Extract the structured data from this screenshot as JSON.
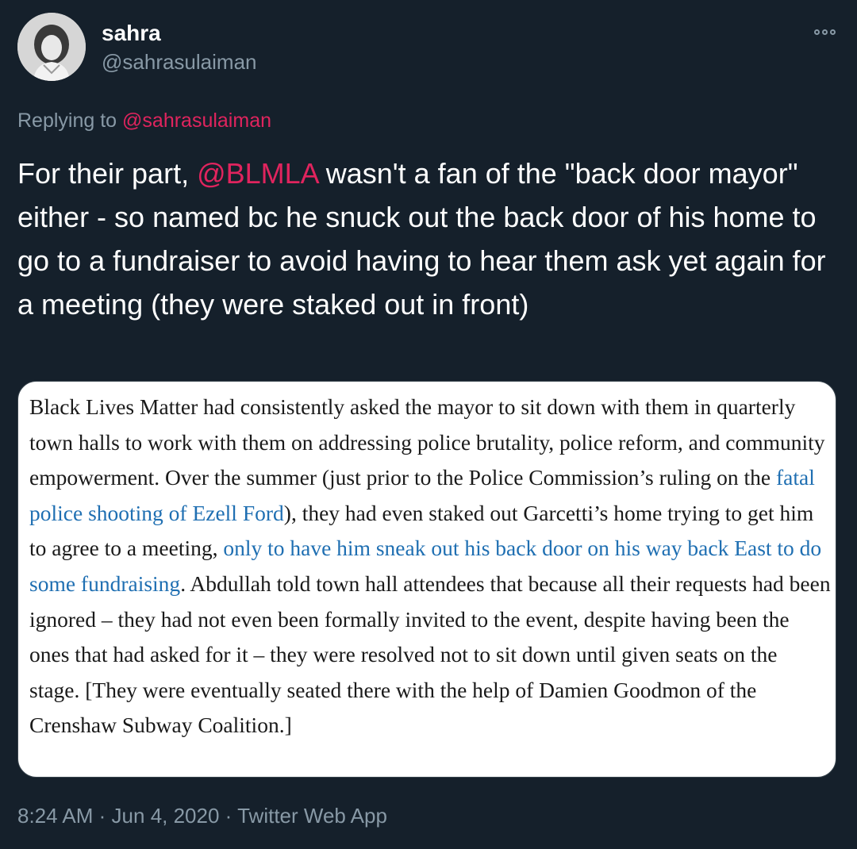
{
  "author": {
    "display_name": "sahra",
    "handle": "@sahrasulaiman"
  },
  "reply": {
    "prefix": "Replying to",
    "to_handle": "@sahrasulaiman"
  },
  "tweet": {
    "text_before_mention": "For their part,",
    "mention": "@BLMLA",
    "text_after_mention": "wasn't a fan of the \"back door mayor\" either - so named bc he snuck out the back door of his home to go to a fundraiser to avoid having to hear them ask yet again for a meeting (they were staked out in front)"
  },
  "quote_image": {
    "text_1": "Black Lives Matter had consistently asked the mayor to sit down with them in quarterly town halls to work with them on addressing police brutality, police reform, and community empowerment. Over the summer (just prior to the Police Commission’s ruling on the",
    "link_1": "fatal police shooting of Ezell Ford",
    "text_2": "), they had even staked out Garcetti’s home trying to get him to agree to a meeting,",
    "link_2": "only to have him sneak out his back door on his way back East to do some fundraising",
    "text_3": ". Abdullah told town hall attendees that because all their requests had been ignored – they had not even been formally invited to the event, despite having been the ones that had asked for it – they were resolved not to sit down until given seats on the stage. [They were eventually seated there with the help of Damien Goodmon of the Crenshaw Subway Coalition.]"
  },
  "footer": {
    "time": "8:24 AM",
    "separator": "·",
    "date": "Jun 4, 2020",
    "source": "Twitter Web App"
  },
  "colors": {
    "background": "#15202b",
    "mention_pink": "#e0245e",
    "secondary_text": "#8899a6",
    "quote_link_blue": "#1f6fb2"
  },
  "icons": {
    "more": "more-options-icon"
  }
}
